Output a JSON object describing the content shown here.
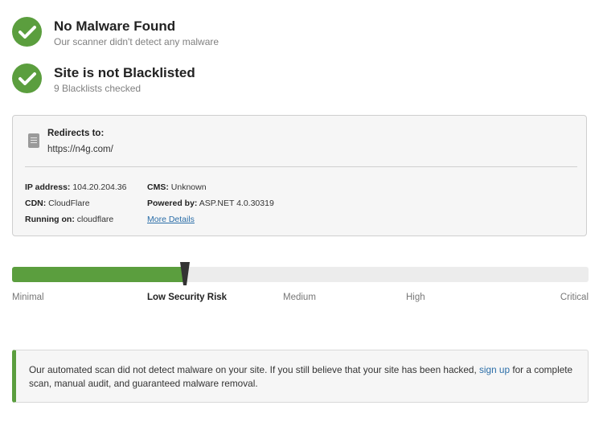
{
  "status": {
    "malware": {
      "title": "No Malware Found",
      "subtitle": "Our scanner didn't detect any malware",
      "icon": "check-icon"
    },
    "blacklist": {
      "title": "Site is not Blacklisted",
      "subtitle": "9 Blacklists checked",
      "icon": "check-icon"
    }
  },
  "site_info": {
    "redirect_label": "Redirects to:",
    "redirect_url": "https://n4g.com/",
    "ip_label": "IP address:",
    "ip_value": "104.20.204.36",
    "cdn_label": "CDN:",
    "cdn_value": "CloudFlare",
    "running_label": "Running on:",
    "running_value": "cloudflare",
    "cms_label": "CMS:",
    "cms_value": "Unknown",
    "powered_label": "Powered by:",
    "powered_value": "ASP.NET 4.0.30319",
    "more_details": "More Details"
  },
  "risk": {
    "level_fraction": 0.3,
    "labels": [
      "Minimal",
      "Low Security Risk",
      "Medium",
      "High",
      "Critical"
    ],
    "active": "Low Security Risk"
  },
  "notice": {
    "text_before": "Our automated scan did not detect malware on your site. If you still believe that your site has been hacked, ",
    "link": "sign up",
    "text_after": " for a complete scan, manual audit, and guaranteed malware removal."
  },
  "colors": {
    "accent_green": "#5b9e3e",
    "link_blue": "#2b6ea8"
  }
}
